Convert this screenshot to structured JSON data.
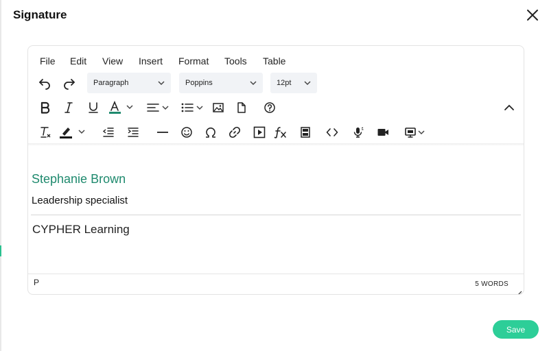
{
  "modal": {
    "title": "Signature"
  },
  "menubar": {
    "items": [
      "File",
      "Edit",
      "View",
      "Insert",
      "Format",
      "Tools",
      "Table"
    ]
  },
  "toolbar": {
    "block_format": "Paragraph",
    "font_family": "Poppins",
    "font_size": "12pt",
    "icons": {
      "undo": "undo-icon",
      "redo": "redo-icon",
      "bold": "bold-icon",
      "italic": "italic-icon",
      "underline": "underline-icon",
      "text_color": "text-color-icon",
      "align": "align-left-icon",
      "list": "bullet-list-icon",
      "image": "image-icon",
      "document": "document-icon",
      "help": "help-icon",
      "collapse": "chevron-up-icon",
      "clear_format": "clear-formatting-icon",
      "highlight": "highlight-icon",
      "outdent": "outdent-icon",
      "indent": "indent-icon",
      "hr": "horizontal-line-icon",
      "emoji": "emoji-icon",
      "special_char": "omega-icon",
      "link": "link-icon",
      "media": "media-play-icon",
      "formula": "formula-icon",
      "template": "template-icon",
      "code": "code-icon",
      "voice": "microphone-icon",
      "video": "video-camera-icon",
      "screen": "screen-record-icon"
    },
    "text_color_swatch": "#1f8a6e"
  },
  "content": {
    "name": "Stephanie Brown",
    "role": "Leadership specialist",
    "company": "CYPHER Learning"
  },
  "statusbar": {
    "path": "P",
    "word_count": "5 WORDS"
  },
  "actions": {
    "save_label": "Save"
  },
  "colors": {
    "accent": "#2dce98",
    "name_color": "#1f8a6e"
  }
}
